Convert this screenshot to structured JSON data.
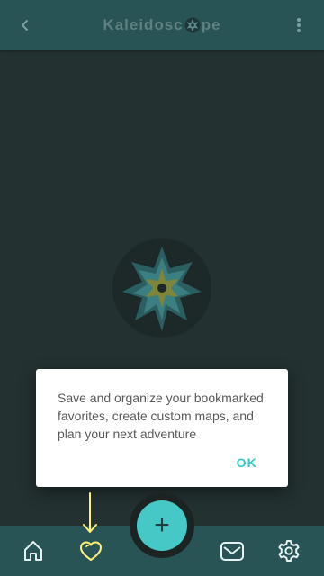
{
  "app_bar": {
    "title_start": "Kaleidosc",
    "title_end": "pe",
    "back_icon": "chevron-left-icon",
    "menu_icon": "more-vert-icon"
  },
  "dialog": {
    "message": "Save and organize your bookmarked favorites, create custom maps, and plan your next adventure",
    "ok_label": "OK"
  },
  "bottom_nav": {
    "items": [
      {
        "icon": "home-icon"
      },
      {
        "icon": "heart-icon",
        "highlighted": true
      },
      {
        "icon": "mail-icon"
      },
      {
        "icon": "gear-icon"
      }
    ],
    "fab_label": "+"
  },
  "colors": {
    "background": "#243131",
    "bar": "#285456",
    "accent": "#46c9c6",
    "highlight": "#ffef77",
    "dialog_text": "#5a5a5a"
  }
}
